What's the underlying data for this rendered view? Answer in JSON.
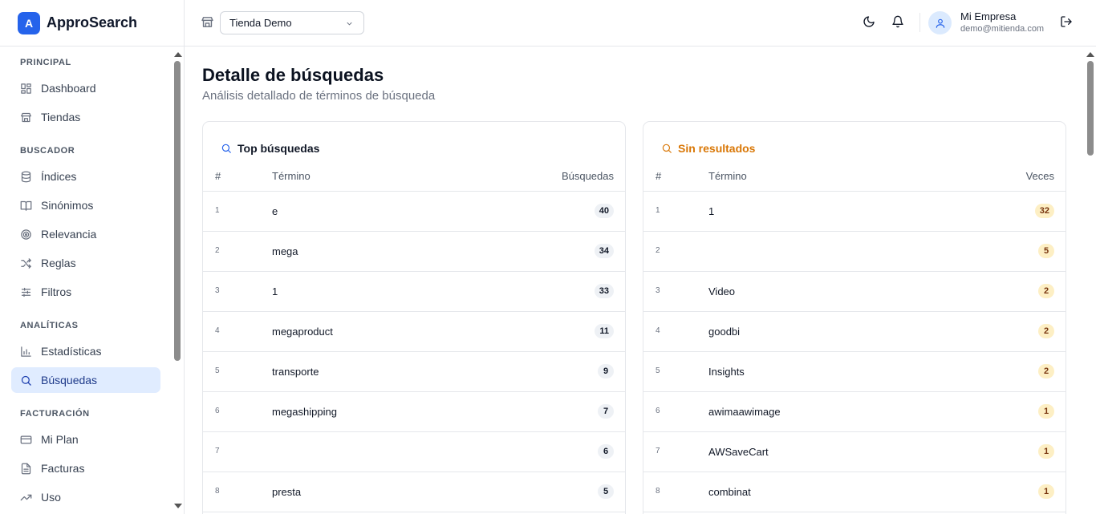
{
  "brand": {
    "logo_letter": "A",
    "name": "ApproSearch",
    "accent": "#2563eb"
  },
  "sidebar": {
    "sections": [
      {
        "title": "PRINCIPAL",
        "items": [
          {
            "label": "Dashboard",
            "icon": "dashboard-icon"
          },
          {
            "label": "Tiendas",
            "icon": "store-icon"
          }
        ]
      },
      {
        "title": "BUSCADOR",
        "items": [
          {
            "label": "Índices",
            "icon": "database-icon"
          },
          {
            "label": "Sinónimos",
            "icon": "book-icon"
          },
          {
            "label": "Relevancia",
            "icon": "target-icon"
          },
          {
            "label": "Reglas",
            "icon": "shuffle-icon"
          },
          {
            "label": "Filtros",
            "icon": "sliders-icon"
          }
        ]
      },
      {
        "title": "ANALÍTICAS",
        "items": [
          {
            "label": "Estadísticas",
            "icon": "bar-chart-icon"
          },
          {
            "label": "Búsquedas",
            "icon": "search-icon",
            "active": true
          }
        ]
      },
      {
        "title": "FACTURACIÓN",
        "items": [
          {
            "label": "Mi Plan",
            "icon": "credit-card-icon"
          },
          {
            "label": "Facturas",
            "icon": "file-icon"
          },
          {
            "label": "Uso",
            "icon": "trending-up-icon"
          }
        ]
      }
    ]
  },
  "header": {
    "store_select_value": "Tienda Demo",
    "user_name": "Mi Empresa",
    "user_email": "demo@mitienda.com"
  },
  "page": {
    "title": "Detalle de búsquedas",
    "subtitle": "Análisis detallado de términos de búsqueda"
  },
  "top_searches": {
    "title": "Top búsquedas",
    "title_color": "#111827",
    "icon_color": "#2563eb",
    "columns": {
      "rank": "#",
      "term": "Término",
      "count": "Búsquedas"
    },
    "rows": [
      {
        "rank": "1",
        "term": "e",
        "count": "40"
      },
      {
        "rank": "2",
        "term": "mega",
        "count": "34"
      },
      {
        "rank": "3",
        "term": "1",
        "count": "33"
      },
      {
        "rank": "4",
        "term": "megaproduct",
        "count": "11"
      },
      {
        "rank": "5",
        "term": "transporte",
        "count": "9"
      },
      {
        "rank": "6",
        "term": "megashipping",
        "count": "7"
      },
      {
        "rank": "7",
        "term": "",
        "count": "6"
      },
      {
        "rank": "8",
        "term": "presta",
        "count": "5"
      }
    ]
  },
  "no_results": {
    "title": "Sin resultados",
    "title_color": "#d97706",
    "columns": {
      "rank": "#",
      "term": "Término",
      "count": "Veces"
    },
    "rows": [
      {
        "rank": "1",
        "term": "1",
        "count": "32"
      },
      {
        "rank": "2",
        "term": "",
        "count": "5"
      },
      {
        "rank": "3",
        "term": "Video",
        "count": "2"
      },
      {
        "rank": "4",
        "term": "goodbi",
        "count": "2"
      },
      {
        "rank": "5",
        "term": "Insights",
        "count": "2"
      },
      {
        "rank": "6",
        "term": "awimaawimage",
        "count": "1"
      },
      {
        "rank": "7",
        "term": "AWSaveCart",
        "count": "1"
      },
      {
        "rank": "8",
        "term": "combinat",
        "count": "1"
      }
    ]
  }
}
